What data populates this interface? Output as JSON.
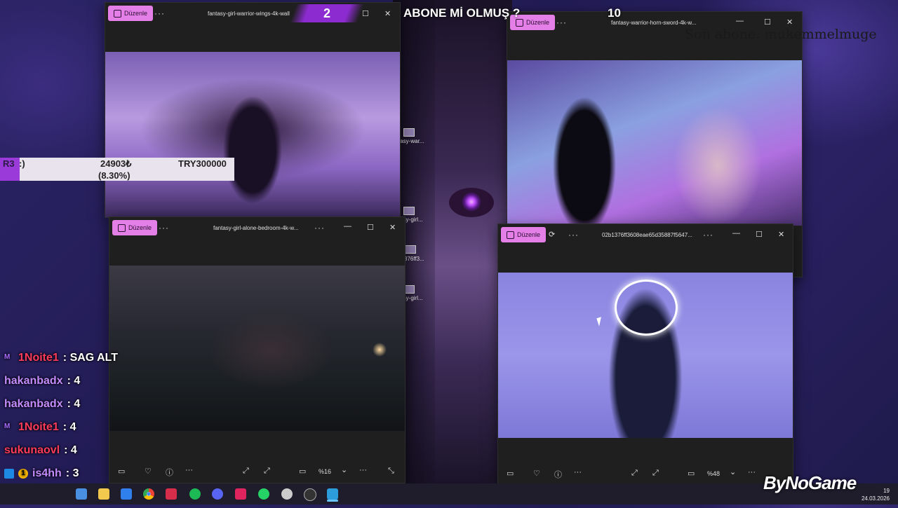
{
  "overlay": {
    "goal_number": "2",
    "question": "ABONE Mİ OLMUŞ ?",
    "subscriber_count": "10",
    "last_subscriber": "Son abone: mukemmelmuge",
    "donation": {
      "tag": "R3",
      "note": ":)",
      "amount": "24903₺",
      "percent": "(8.30%)",
      "goal": "TRY300000",
      "progress_fraction": 0.083
    }
  },
  "desktop_labels": [
    "tasy-war...",
    "tasy-girl...",
    "376ff3...",
    "tasy-girl..."
  ],
  "windows": {
    "wings": {
      "edit": "Düzenle",
      "more": "···",
      "filename": "fantasy-girl-warrior-wings-4k-wall"
    },
    "sword": {
      "edit": "Düzenle",
      "more": "···",
      "filename": "fantasy-warrior-horn-sword-4k-w..."
    },
    "bedroom": {
      "edit": "Düzenle",
      "more": "···",
      "filename": "fantasy-girl-alone-bedroom-4k-w...",
      "zoom": "%16"
    },
    "nun": {
      "edit": "Düzenle",
      "more": "···",
      "filename": "02b1376ff3608eae65d35887f5647...",
      "zoom": "%48"
    }
  },
  "window_controls": {
    "minimize": "—",
    "maximize": "☐",
    "close": "✕"
  },
  "toolbar_glyphs": {
    "filmstrip": "▭",
    "favorite": "♡",
    "info": "ⓘ",
    "more": "···",
    "fit": "⤢",
    "chevron": "⌄",
    "fullscreen": "⤡"
  },
  "chat": [
    {
      "user": "1Noite1",
      "message": ": SAG ALT",
      "badge": "M"
    },
    {
      "user": "hakanbadx",
      "message": ": 4",
      "badge": ""
    },
    {
      "user": "hakanbadx",
      "message": ": 4",
      "badge": ""
    },
    {
      "user": "1Noite1",
      "message": ": 4",
      "badge": "M"
    },
    {
      "user": "sukunaovl",
      "message": ": 4",
      "badge": ""
    },
    {
      "user": "is4hh",
      "message": ": 3",
      "badge": "1"
    },
    {
      "user": "is4hh",
      "message": ": 3",
      "badge": "1"
    }
  ],
  "watermark": "ByNoGame",
  "clock": {
    "time": "19",
    "date": "24.03.2026"
  },
  "colors": {
    "accent_pink": "#e47fe8",
    "banner_purple": "#8c2bd0",
    "taskbar": "#1f1c2b"
  }
}
